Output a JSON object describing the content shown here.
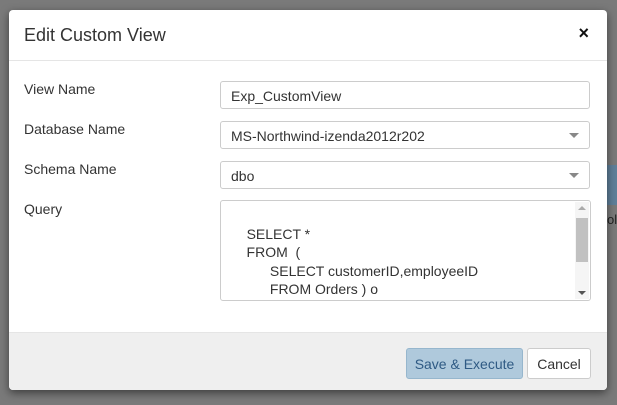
{
  "background": {
    "partial_text": "olu"
  },
  "dialog": {
    "title": "Edit Custom View",
    "close_icon": "×",
    "view_name": {
      "label": "View Name",
      "value": "Exp_CustomView"
    },
    "database_name": {
      "label": "Database Name",
      "value": "MS-Northwind-izenda2012r202"
    },
    "schema_name": {
      "label": "Schema Name",
      "value": "dbo"
    },
    "query": {
      "label": "Query",
      "value": "SELECT *\n    FROM  (\n          SELECT customerID,employeeID\n          FROM Orders ) o\n    PIVOT (\n          COUNT(employeeID)"
    },
    "save_label": "Save & Execute",
    "cancel_label": "Cancel"
  }
}
